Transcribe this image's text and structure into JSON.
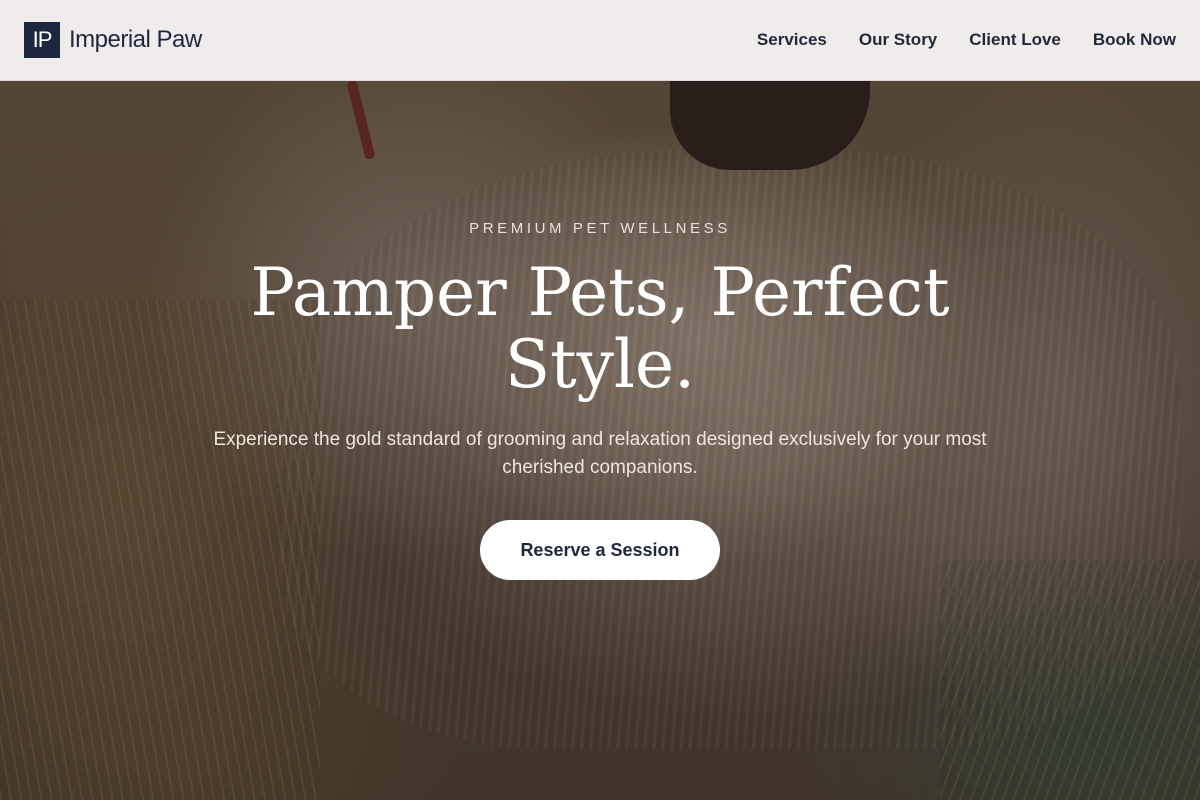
{
  "brand": {
    "mark": "IP",
    "name": "Imperial Paw"
  },
  "nav": {
    "items": [
      "Services",
      "Our Story",
      "Client Love",
      "Book Now"
    ]
  },
  "hero": {
    "eyebrow": "PREMIUM PET WELLNESS",
    "headline": "Pamper Pets, Perfect Style.",
    "subtext": "Experience the gold standard of grooming and relaxation designed exclusively for your most cherished companions.",
    "cta_label": "Reserve a Session"
  },
  "colors": {
    "header_bg": "#efeceb",
    "brand_navy": "#1d2840",
    "cta_bg": "#ffffff"
  }
}
